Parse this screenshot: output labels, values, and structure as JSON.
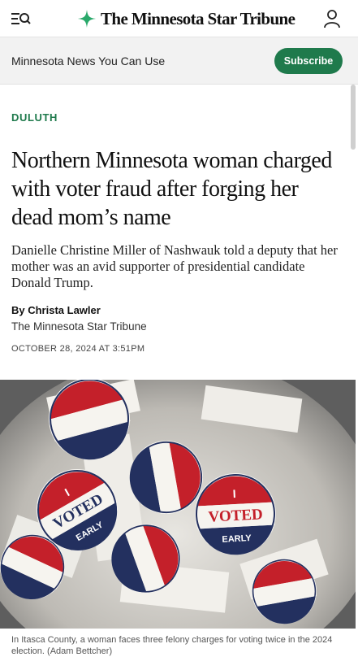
{
  "header": {
    "logo_text": "The Minnesota Star Tribune",
    "icons": {
      "menu": "menu-search-icon",
      "logo": "star-logo-icon",
      "account": "user-account-icon"
    }
  },
  "promo": {
    "text": "Minnesota News You Can Use",
    "subscribe_label": "Subscribe"
  },
  "article": {
    "kicker": "DULUTH",
    "headline": "Northern Minnesota woman charged with voter fraud after forging her dead mom’s name",
    "dek": "Danielle Christine Miller of Nashwauk told a deputy that her mother was an avid supporter of presidential candidate Donald Trump.",
    "byline": "By Christa Lawler",
    "outlet": "The Minnesota Star Tribune",
    "date": "OCTOBER 28, 2024 AT 3:51PM"
  },
  "photo": {
    "sticker_top_text": "I",
    "sticker_main_text": "VOTED",
    "sticker_bottom_text": "EARLY",
    "caption": "In Itasca County, a woman faces three felony charges for voting twice in the 2024 election. (Adam Bettcher)"
  },
  "colors": {
    "brand_green": "#1f7a4c",
    "sticker_red": "#c4202a",
    "sticker_blue": "#23305f"
  }
}
